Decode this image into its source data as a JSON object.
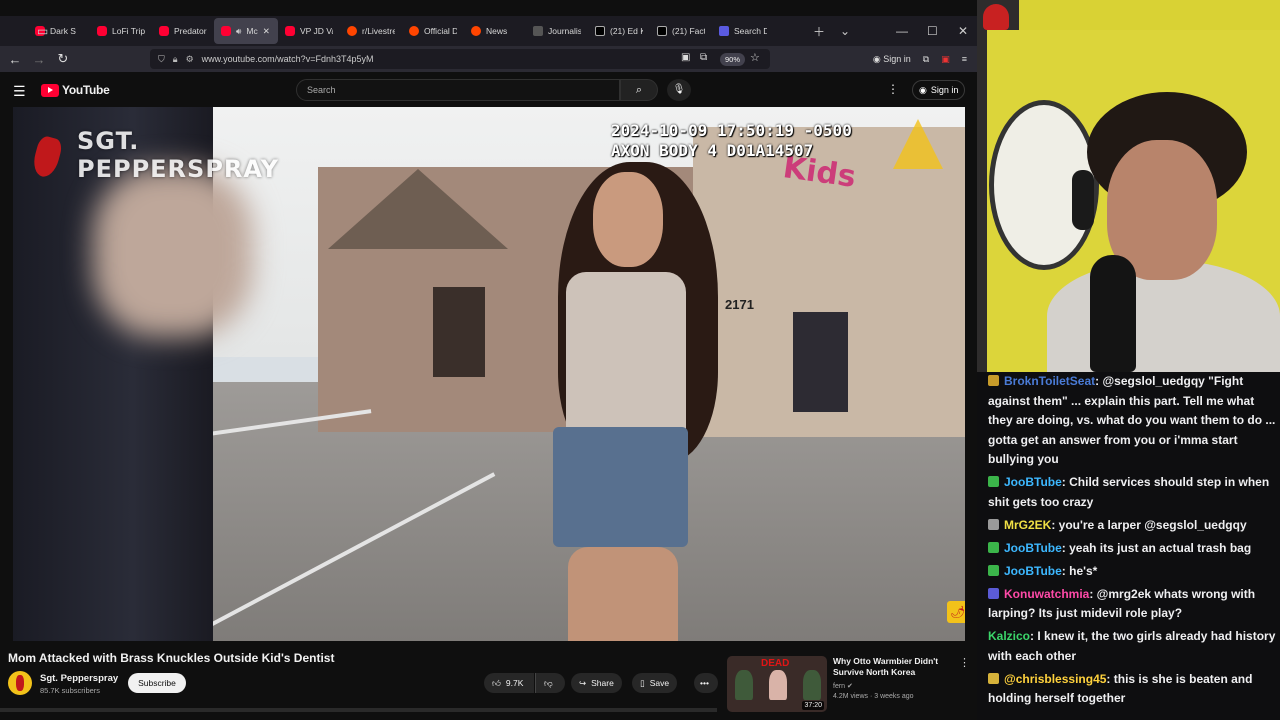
{
  "browser": {
    "tabs": [
      {
        "label": "Dark S",
        "favicon": "youtube",
        "active": false
      },
      {
        "label": "LoFi Tripl",
        "favicon": "youtube",
        "active": false
      },
      {
        "label": "Predator",
        "favicon": "youtube",
        "active": false
      },
      {
        "label": "Mc",
        "favicon": "youtube",
        "active": true
      },
      {
        "label": "VP JD Va",
        "favicon": "youtube",
        "active": false
      },
      {
        "label": "r/Livestre",
        "favicon": "reddit",
        "active": false
      },
      {
        "label": "Official D",
        "favicon": "reddit",
        "active": false
      },
      {
        "label": "News",
        "favicon": "reddit",
        "active": false
      },
      {
        "label": "Journalis",
        "favicon": "ap",
        "active": false
      },
      {
        "label": "(21) Ed K",
        "favicon": "x",
        "active": false
      },
      {
        "label": "(21) Fact",
        "favicon": "x",
        "active": false
      },
      {
        "label": "Search D",
        "favicon": "ms",
        "active": false
      }
    ],
    "url": "www.youtube.com/watch?v=Fdnh3T4p5yM",
    "zoom": "90%",
    "signin_label": "Sign in"
  },
  "youtube": {
    "logo_text": "YouTube",
    "search_placeholder": "Search",
    "signin_label": "Sign in",
    "video": {
      "watermark_line1": "SGT.",
      "watermark_line2": "PEPPERSPRAY",
      "timestamp_line1": "2024-10-09 17:50:19 -0500",
      "timestamp_line2": "AXON BODY 4 D01A14507",
      "sign_text": "Kids",
      "address": "2171"
    },
    "title": "Mom Attacked with Brass Knuckles Outside Kid's Dentist",
    "channel": {
      "name": "Sgt. Pepperspray",
      "subscribers": "85.7K subscribers",
      "subscribe_label": "Subscribe"
    },
    "actions": {
      "likes": "9.7K",
      "share": "Share",
      "save": "Save"
    },
    "recommended": {
      "thumb_text": "DEAD",
      "duration": "37:20",
      "title": "Why Otto Warmbier Didn't Survive North Korea",
      "channel": "fern",
      "meta": "4.2M views · 3 weeks ago"
    }
  },
  "chat": [
    {
      "user": "BroknToiletSeat",
      "color": "#4a7bd6",
      "badge": "#c89c2a",
      "text": ": @segslol_uedgqy \"Fight against them\" ... explain this part. Tell me what they are doing, vs. what do you want them to do ... gotta get an answer from you or i'mma start bullying you"
    },
    {
      "user": "JooBTube",
      "color": "#3db8ff",
      "badge": "#3bb54a",
      "text": ": Child services should step in when shit gets too crazy"
    },
    {
      "user": "MrG2EK",
      "color": "#f0e045",
      "badge": "#9a9a9a",
      "text": ": you're a larper @segslol_uedgqy"
    },
    {
      "user": "JooBTube",
      "color": "#3db8ff",
      "badge": "#3bb54a",
      "text": ": yeah its just an actual trash bag"
    },
    {
      "user": "JooBTube",
      "color": "#3db8ff",
      "badge": "#3bb54a",
      "text": ": he's*"
    },
    {
      "user": "Konuwatchmia",
      "color": "#ff4aa8",
      "badge": "#5b5bd6",
      "text": ": @mrg2ek whats wrong with larping? Its just midevil role play?"
    },
    {
      "user": "Kalzico",
      "color": "#3bd66a",
      "badge": "",
      "text": ": I knew it, the two girls already had history with each other"
    },
    {
      "user": "@chrisblessing45",
      "color": "#ffd23d",
      "badge": "#d6b23a",
      "text": ": this is she is beaten and holding herself together"
    }
  ]
}
